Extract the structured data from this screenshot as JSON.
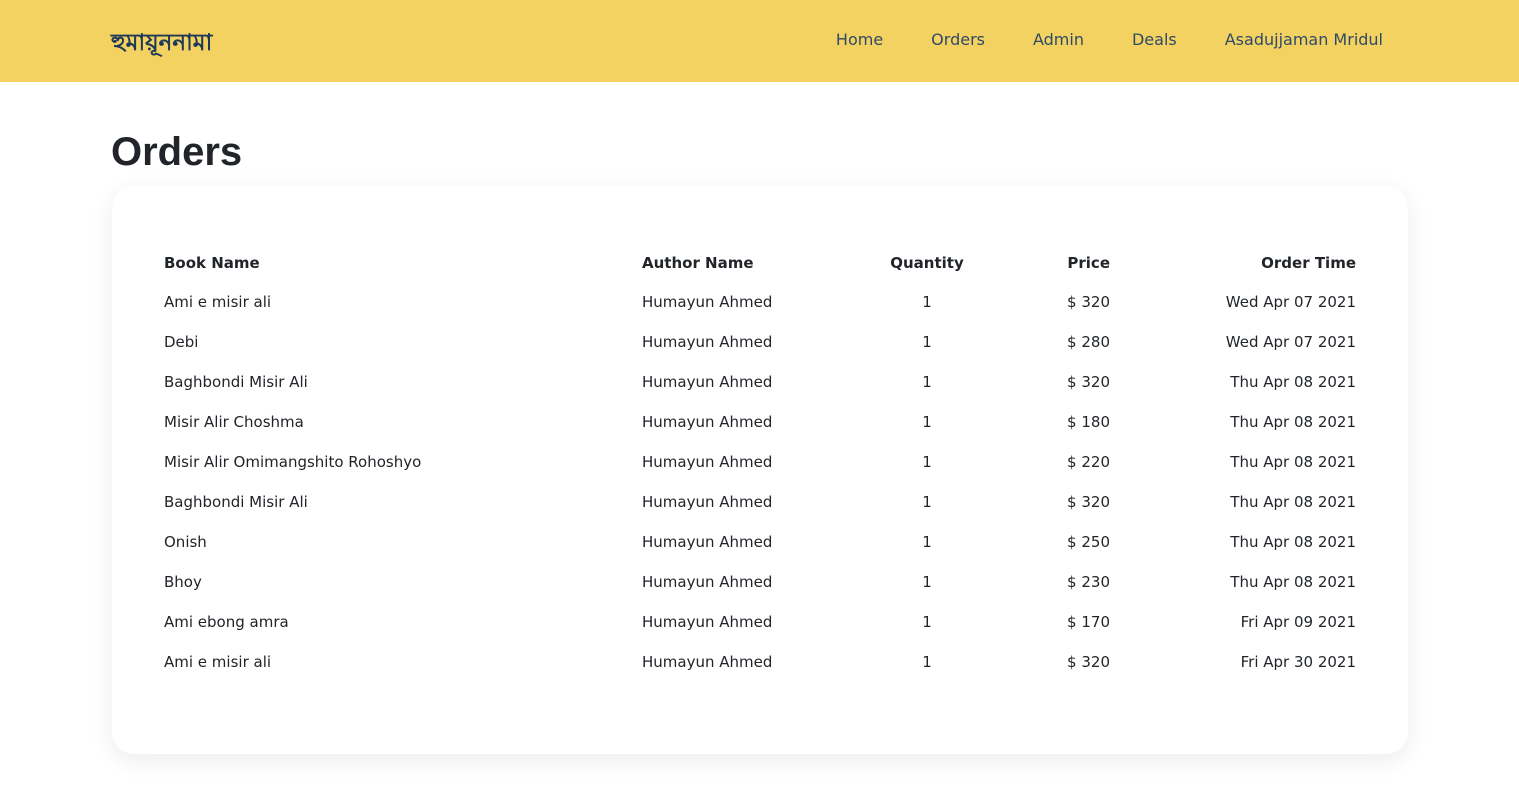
{
  "navbar": {
    "brand": "হুমায়ূননামা",
    "links": [
      "Home",
      "Orders",
      "Admin",
      "Deals",
      "Asadujjaman Mridul"
    ]
  },
  "page": {
    "title": "Orders"
  },
  "table": {
    "headers": {
      "book": "Book Name",
      "author": "Author Name",
      "quantity": "Quantity",
      "price": "Price",
      "time": "Order Time"
    },
    "rows": [
      {
        "book": "Ami e misir ali",
        "author": "Humayun Ahmed",
        "quantity": "1",
        "price": "$ 320",
        "time": "Wed Apr 07 2021"
      },
      {
        "book": "Debi",
        "author": "Humayun Ahmed",
        "quantity": "1",
        "price": "$ 280",
        "time": "Wed Apr 07 2021"
      },
      {
        "book": "Baghbondi Misir Ali",
        "author": "Humayun Ahmed",
        "quantity": "1",
        "price": "$ 320",
        "time": "Thu Apr 08 2021"
      },
      {
        "book": "Misir Alir Choshma",
        "author": "Humayun Ahmed",
        "quantity": "1",
        "price": "$ 180",
        "time": "Thu Apr 08 2021"
      },
      {
        "book": "Misir Alir Omimangshito Rohoshyo",
        "author": "Humayun Ahmed",
        "quantity": "1",
        "price": "$ 220",
        "time": "Thu Apr 08 2021"
      },
      {
        "book": "Baghbondi Misir Ali",
        "author": "Humayun Ahmed",
        "quantity": "1",
        "price": "$ 320",
        "time": "Thu Apr 08 2021"
      },
      {
        "book": "Onish",
        "author": "Humayun Ahmed",
        "quantity": "1",
        "price": "$ 250",
        "time": "Thu Apr 08 2021"
      },
      {
        "book": "Bhoy",
        "author": "Humayun Ahmed",
        "quantity": "1",
        "price": "$ 230",
        "time": "Thu Apr 08 2021"
      },
      {
        "book": "Ami ebong amra",
        "author": "Humayun Ahmed",
        "quantity": "1",
        "price": "$ 170",
        "time": "Fri Apr 09 2021"
      },
      {
        "book": "Ami e misir ali",
        "author": "Humayun Ahmed",
        "quantity": "1",
        "price": "$ 320",
        "time": "Fri Apr 30 2021"
      }
    ]
  },
  "colors": {
    "navbar_bg": "#f4d262",
    "brand_text": "#1f3a57",
    "nav_text": "#2e4a66"
  }
}
